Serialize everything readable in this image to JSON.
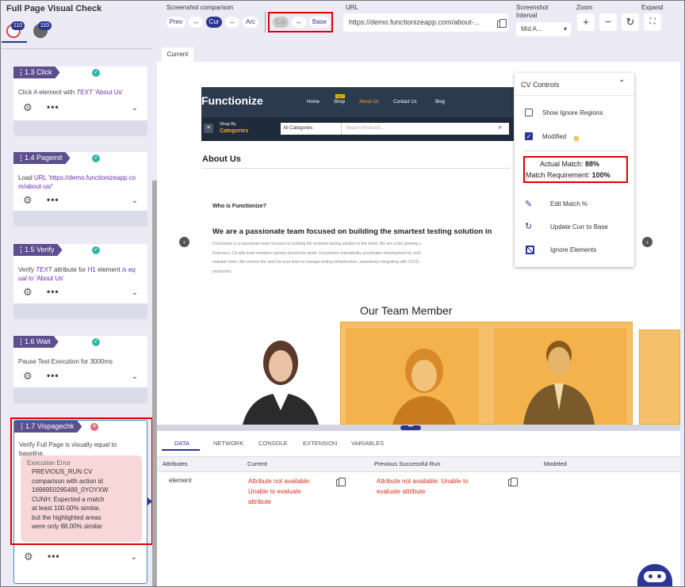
{
  "panel": {
    "title": "Full Page Visual Check",
    "badge1": "110",
    "badge2": "110"
  },
  "steps": [
    {
      "tag": "1.3 Click",
      "status": "ok"
    },
    {
      "tag": "1.4 Pageinit",
      "status": "ok"
    },
    {
      "tag": "1.5 Verify",
      "status": "ok"
    },
    {
      "tag": "1.6 Wait",
      "status": "ok"
    },
    {
      "tag": "1.7 Vispagechk",
      "status": "error"
    }
  ],
  "step13": {
    "a": "Click",
    "b": "A",
    "c": "element with",
    "d": "TEXT",
    "e": "'About Us'"
  },
  "step14": {
    "a": "Load",
    "b": "URL",
    "c": "'https://demo.functionizeapp.co",
    "d": "m/about-us/'"
  },
  "step15": {
    "a": "Verify",
    "b": "TEXT",
    "c": "attribute for",
    "d": "H1",
    "e": "element",
    "f": "is eq",
    "g": "ual to",
    "h": "'About Us'"
  },
  "step16": {
    "desc": "Pause Test Execution for 3000ms"
  },
  "step17": {
    "desc": "Verify Full Page is visually equal to baseline.",
    "err_title": "Execution Error",
    "err_lines": [
      "PREVIOUS_RUN CV",
      "comparison with action id",
      "1696950295489_0YOYXW",
      "CUNH: Expected a match",
      "at least 100.00% similar,",
      "but the highlighted areas",
      "were only 88.00% similar"
    ]
  },
  "toolbar": {
    "sc_label": "Screenshot comparison",
    "prev": "Prev",
    "arrows": "↔",
    "cur": "Cur",
    "arc": "Arc",
    "cur2": "Cur",
    "base": "Base",
    "url_label": "URL",
    "url_value": "https://demo.functionizeapp.com/about-...",
    "interval_label1": "Screenshot",
    "interval_label2": "Interval",
    "interval_value": "Mid A...",
    "zoom_label": "Zoom",
    "expand_label": "Expand"
  },
  "current_tab": "Current",
  "site": {
    "logo": "Functionize",
    "nav": [
      "Home",
      "Shop",
      "About Us",
      "Contact Us",
      "Blog"
    ],
    "hot": "HOT",
    "shop_by": "Shop By",
    "categories": "Categories",
    "all_categories": "All Categories",
    "search_ph": "Search Products...",
    "about_title": "About Us",
    "who": "Who is Functionize?",
    "headline": "We are a passionate team focused on building the smartest testing solution in",
    "para1": "Functionize is a passionate team focused on building the smartest testing solution in the world. We are a fast growing s",
    "para2": "Francisco, CA with team members spread around the world. Functionize dramatically accelerates development by redu",
    "para3": "maintain tests. We remove the need for your team to manage testing infrastructure, seamlessly integrating with CI/CD,",
    "para4": "production.",
    "team_title": "Our Team Member"
  },
  "cv": {
    "title": "CV Controls",
    "show_ignore": "Show Ignore Regions",
    "modified": "Modified",
    "actual_label": "Actual Match:",
    "actual_value": "88%",
    "req_label": "Match Requirement:",
    "req_value": "100%",
    "edit": "Edit Match %",
    "update": "Update Curr to Base",
    "ignore": "Ignore Elements"
  },
  "tabs": [
    "DATA",
    "NETWORK",
    "CONSOLE",
    "EXTENSION",
    "VARIABLES"
  ],
  "table": {
    "headers": [
      "Attributes",
      "Current",
      "Previous Successful Run",
      "Modeled"
    ],
    "attr": "element",
    "cur1": "Attribute not available:",
    "cur2": "Unable to evaluate",
    "cur3": "attribute",
    "prev1": "Attribute not available: Unable to",
    "prev2": "evaluate attribute"
  },
  "colors": {
    "accent": "#2b3595",
    "tag": "#5d4f8f",
    "ok": "#2fb8a6",
    "error": "#e00000"
  }
}
